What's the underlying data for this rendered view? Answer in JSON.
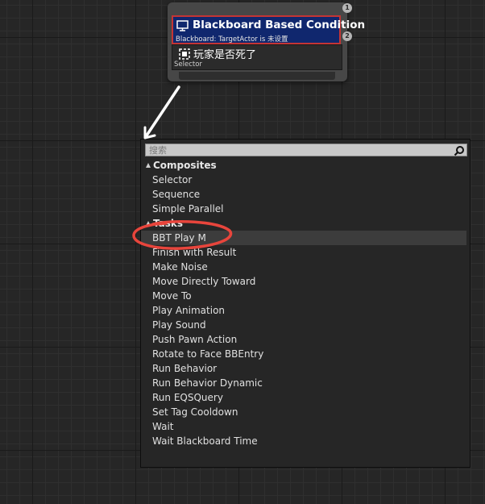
{
  "node": {
    "pin_top": "1",
    "pin_mid": "2",
    "decorator_title": "Blackboard Based Condition",
    "decorator_desc": "Blackboard: TargetActor is 未设置",
    "composite_title": "玩家是否死了",
    "composite_sub": "Selector"
  },
  "search": {
    "placeholder": "搜索"
  },
  "menu": {
    "categories": [
      {
        "label": "Composites",
        "items": [
          "Selector",
          "Sequence",
          "Simple Parallel"
        ]
      },
      {
        "label": "Tasks",
        "items": [
          "BBT Play M",
          "Finish with Result",
          "Make Noise",
          "Move Directly Toward",
          "Move To",
          "Play Animation",
          "Play Sound",
          "Push Pawn Action",
          "Rotate to Face BBEntry",
          "Run Behavior",
          "Run Behavior Dynamic",
          "Run EQSQuery",
          "Set Tag Cooldown",
          "Wait",
          "Wait Blackboard Time"
        ]
      }
    ],
    "selected_item": "BBT Play M"
  },
  "colors": {
    "decorator_bg": "#10276e",
    "decorator_border": "#c43535",
    "annotation_red": "#e8453c",
    "annotation_arrow": "#ffffff"
  }
}
